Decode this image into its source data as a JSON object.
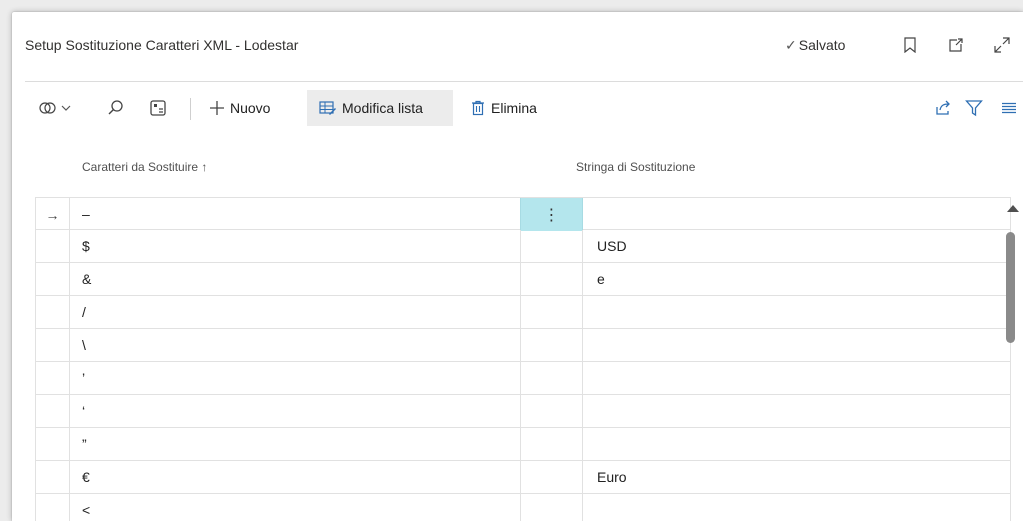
{
  "window": {
    "title": "Setup Sostituzione Caratteri XML - Lodestar",
    "saved_status": "Salvato",
    "bookmark_icon": "bookmark-icon",
    "popout_icon": "open-new-window-icon",
    "expand_icon": "expand-icon"
  },
  "toolbar": {
    "new_label": "Nuovo",
    "edit_list_label": "Modifica lista",
    "delete_label": "Elimina"
  },
  "table": {
    "columns": [
      "Caratteri da Sostituire ↑",
      "Stringa di Sostituzione"
    ],
    "rows": [
      {
        "marker": "→",
        "char": "–",
        "replacement": "",
        "selected": true
      },
      {
        "marker": "",
        "char": "$",
        "replacement": "USD"
      },
      {
        "marker": "",
        "char": "&",
        "replacement": "e"
      },
      {
        "marker": "",
        "char": "/",
        "replacement": ""
      },
      {
        "marker": "",
        "char": "\\",
        "replacement": ""
      },
      {
        "marker": "",
        "char": "’",
        "replacement": ""
      },
      {
        "marker": "",
        "char": "‘",
        "replacement": ""
      },
      {
        "marker": "",
        "char": "”",
        "replacement": ""
      },
      {
        "marker": "",
        "char": "€",
        "replacement": "Euro"
      },
      {
        "marker": "",
        "char": "<",
        "replacement": ""
      }
    ],
    "row_menu_glyph": "⋮"
  },
  "colors": {
    "selected_cell": "#b4e6ed",
    "accent": "#00838f"
  }
}
